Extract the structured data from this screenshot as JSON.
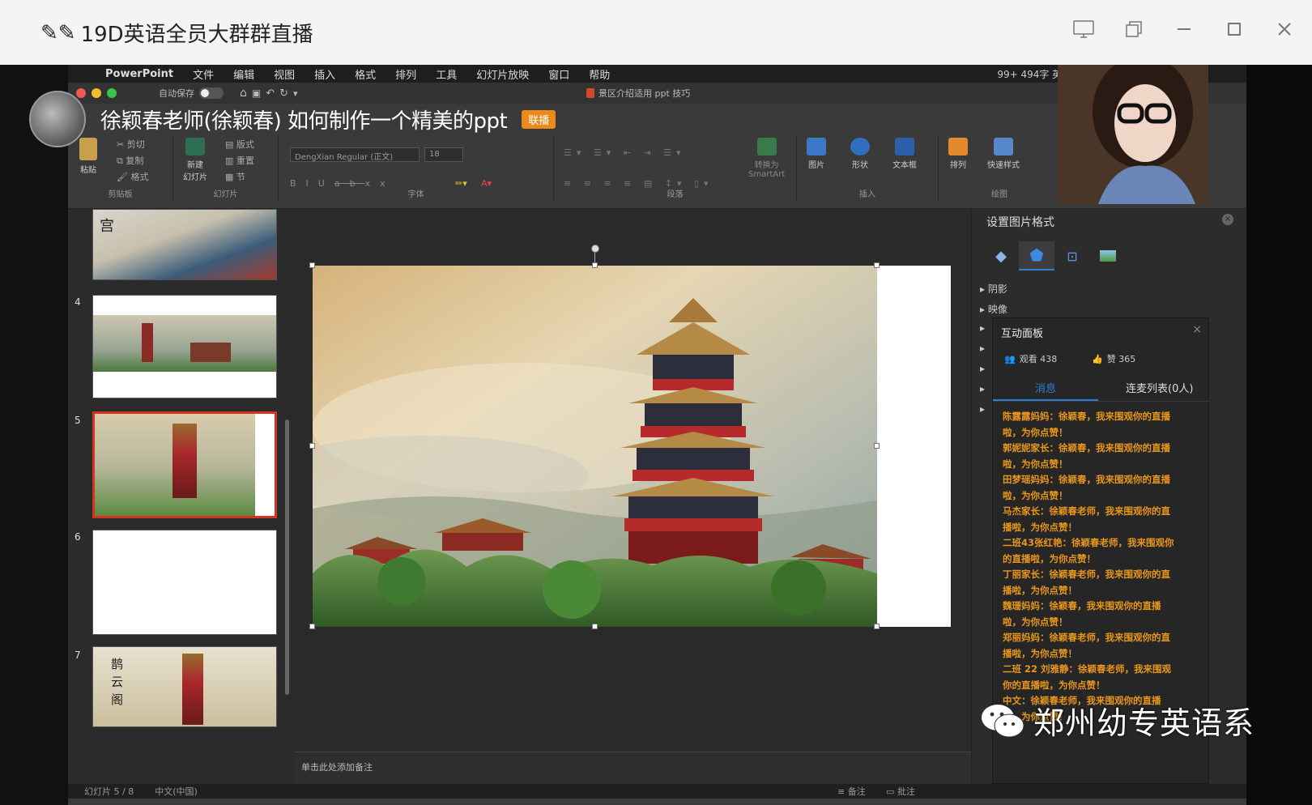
{
  "window": {
    "title": "19D英语全员大群群直播",
    "controls": [
      "screen-share-icon",
      "popout-icon",
      "minimize-icon",
      "maximize-icon",
      "close-icon"
    ]
  },
  "mac_menu": {
    "app": "PowerPoint",
    "items": [
      "文件",
      "编辑",
      "视图",
      "插入",
      "格式",
      "排列",
      "工具",
      "幻灯片放映",
      "窗口",
      "帮助"
    ],
    "status": "99+   494字   英   周二"
  },
  "ppt_titlebar": {
    "autosave_label": "自动保存",
    "document": "景区介绍适用 ppt 技巧"
  },
  "teacher": {
    "name": "徐颖春老师(徐颖春) 如何制作一个精美的ppt",
    "badge": "联播"
  },
  "ribbon": {
    "clipboard": {
      "label": "剪贴板",
      "paste": "粘贴",
      "cut": "剪切",
      "copy": "复制",
      "format": "格式"
    },
    "slides": {
      "label": "幻灯片",
      "new_slide": "新建\n幻灯片",
      "layout": "版式",
      "reset": "重置",
      "section": "节"
    },
    "font": {
      "label": "字体",
      "font_name": "DengXian Regular (正文)",
      "font_size": "18"
    },
    "paragraph": {
      "label": "段落",
      "smartart": "转换为\nSmartArt"
    },
    "insert": {
      "label": "插入",
      "picture": "图片",
      "shape": "形状",
      "textbox": "文本框"
    },
    "drawing": {
      "label": "绘图",
      "arrange": "排列",
      "quick_styles": "快速样式"
    }
  },
  "thumbnails": [
    {
      "num": "",
      "kind": "palace-roof"
    },
    {
      "num": "4",
      "kind": "pagoda-wide"
    },
    {
      "num": "5",
      "kind": "pagoda-selected"
    },
    {
      "num": "6",
      "kind": "blank"
    },
    {
      "num": "7",
      "kind": "pagoda-calligraphy"
    }
  ],
  "thumb_calligraphy": "宫",
  "thumb7_text": "鹊 云 阁",
  "notes_placeholder": "单击此处添加备注",
  "format_pane": {
    "title": "设置图片格式",
    "rows": [
      "阴影",
      "映像"
    ]
  },
  "interactive": {
    "title": "互动面板",
    "viewers_label": "观看 438",
    "likes_label": "赞 365",
    "tab_messages": "消息",
    "tab_mic": "连麦列表(0人)",
    "messages": [
      "陈露露妈妈：徐颖春，我来围观你的直播啦，为你点赞！",
      "郭妮妮家长：徐颖春，我来围观你的直播啦，为你点赞！",
      "田梦瑶妈妈：徐颖春，我来围观你的直播啦，为你点赞！",
      "马杰家长：徐颖春老师，我来围观你的直播啦，为你点赞！",
      "二班43张红艳：徐颖春老师，我来围观你的直播啦，为你点赞！",
      "丁丽家长：徐颖春老师，我来围观你的直播啦，为你点赞！",
      "魏珊妈妈：徐颖春，我来围观你的直播啦，为你点赞！",
      "郑丽妈妈：徐颖春老师，我来围观你的直播啦，为你点赞！",
      "二班 22 刘雅静：徐颖春老师，我来围观你的直播啦，为你点赞！",
      "中文：徐颖春老师，我来围观你的直播啦，为你点赞！"
    ]
  },
  "statusbar": {
    "slide_info": "幻灯片 5 / 8",
    "language": "中文(中国)",
    "notes_btn": "备注",
    "comments_btn": "批注"
  },
  "watermark": "郑州幼专英语系",
  "colors": {
    "accent_orange": "#e8961c",
    "selection_red": "#d3341f",
    "tab_blue": "#2a7fd6"
  }
}
